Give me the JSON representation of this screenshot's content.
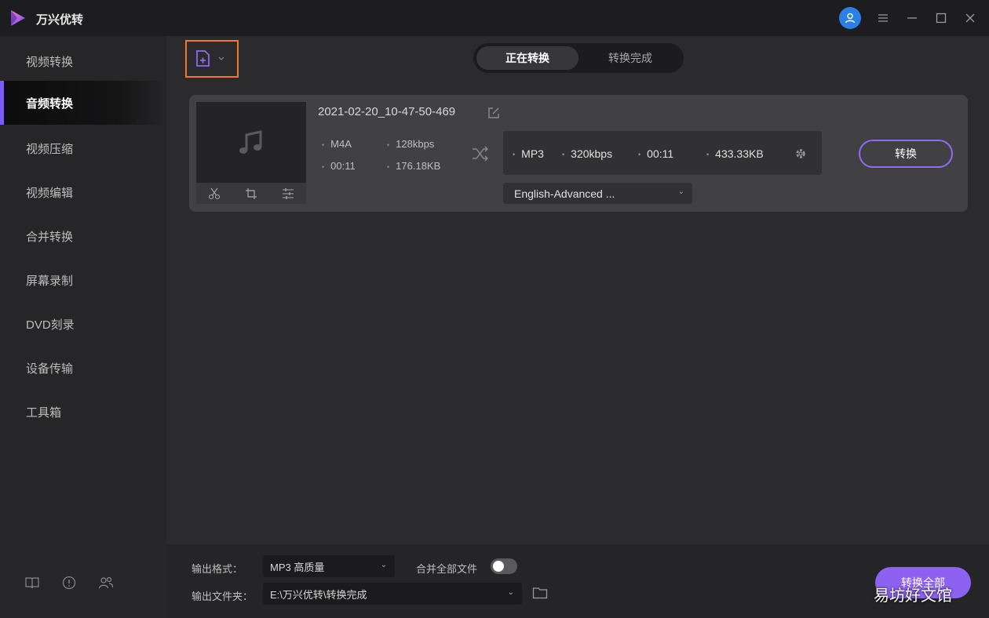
{
  "app": {
    "title": "万兴优转"
  },
  "sidebar": {
    "items": [
      {
        "label": "视频转换"
      },
      {
        "label": "音频转换"
      },
      {
        "label": "视频压缩"
      },
      {
        "label": "视频编辑"
      },
      {
        "label": "合并转换"
      },
      {
        "label": "屏幕录制"
      },
      {
        "label": "DVD刻录"
      },
      {
        "label": "设备传输"
      },
      {
        "label": "工具箱"
      }
    ],
    "active_index": 1
  },
  "tabs": {
    "converting": "正在转换",
    "completed": "转换完成"
  },
  "file": {
    "name": "2021-02-20_10-47-50-469",
    "source_format": "M4A",
    "source_bitrate": "128kbps",
    "source_duration": "00:11",
    "source_size": "176.18KB",
    "target_format": "MP3",
    "target_bitrate": "320kbps",
    "target_duration": "00:11",
    "target_size": "433.33KB",
    "subtitle_track": "English-Advanced ...",
    "convert_label": "转换"
  },
  "bottom": {
    "output_format_label": "输出格式：",
    "output_format_value": "MP3 高质量",
    "merge_label": "合并全部文件",
    "merge_enabled": false,
    "output_folder_label": "输出文件夹：",
    "output_folder_value": "E:\\万兴优转\\转换完成",
    "convert_all_label": "转换全部"
  },
  "watermark": "易坊好文馆",
  "colors": {
    "accent": "#8e62f0",
    "highlight_box": "#f07a2a",
    "avatar": "#2d7fe8"
  }
}
